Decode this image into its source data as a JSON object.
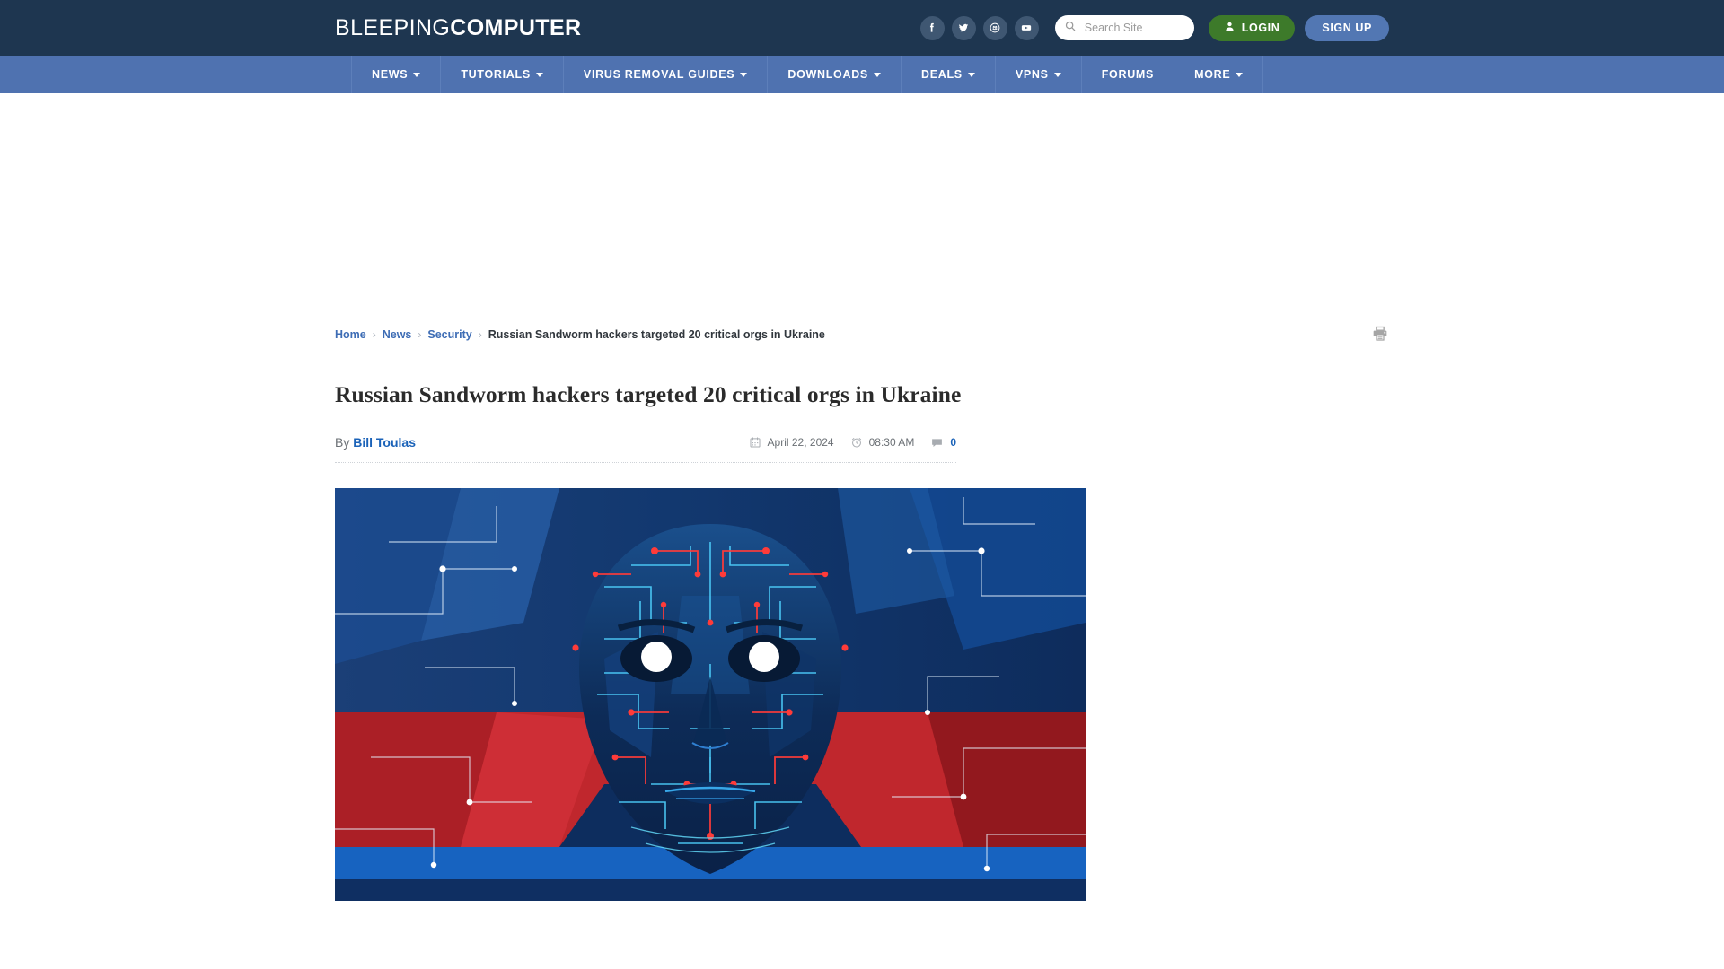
{
  "header": {
    "logo_thin": "BLEEPING",
    "logo_bold": "COMPUTER",
    "social": [
      {
        "name": "facebook-icon",
        "label": "Facebook"
      },
      {
        "name": "twitter-icon",
        "label": "Twitter"
      },
      {
        "name": "mastodon-icon",
        "label": "Mastodon"
      },
      {
        "name": "youtube-icon",
        "label": "YouTube"
      }
    ],
    "search": {
      "placeholder": "Search Site",
      "value": "",
      "icon": "search-icon"
    },
    "login_label": "LOGIN",
    "login_icon": "user-icon",
    "signup_label": "SIGN UP",
    "colors": {
      "header_bg": "#1e3650",
      "nav_bg": "#4f72b0",
      "login_green": "#3d7a2a",
      "signup_blue": "#5277b3",
      "link_blue": "#3e6db5"
    }
  },
  "nav": {
    "items": [
      {
        "label": "NEWS",
        "has_caret": true
      },
      {
        "label": "TUTORIALS",
        "has_caret": true
      },
      {
        "label": "VIRUS REMOVAL GUIDES",
        "has_caret": true
      },
      {
        "label": "DOWNLOADS",
        "has_caret": true
      },
      {
        "label": "DEALS",
        "has_caret": true
      },
      {
        "label": "VPNS",
        "has_caret": true
      },
      {
        "label": "FORUMS",
        "has_caret": false
      },
      {
        "label": "MORE",
        "has_caret": true
      }
    ]
  },
  "breadcrumb": {
    "home": "Home",
    "news": "News",
    "security": "Security",
    "current": "Russian Sandworm hackers targeted 20 critical orgs in Ukraine",
    "separator": "›",
    "print_icon": "printer-icon"
  },
  "article": {
    "title": "Russian Sandworm hackers targeted 20 critical orgs in Ukraine",
    "by_prefix": "By",
    "author": "Bill Toulas",
    "date": "April 22, 2024",
    "date_icon": "calendar-icon",
    "time": "08:30 AM",
    "time_icon": "clock-icon",
    "comments": "0",
    "comments_icon": "comment-icon",
    "hero_alt": "Circuit-board face illustration over Russian flag colors"
  }
}
